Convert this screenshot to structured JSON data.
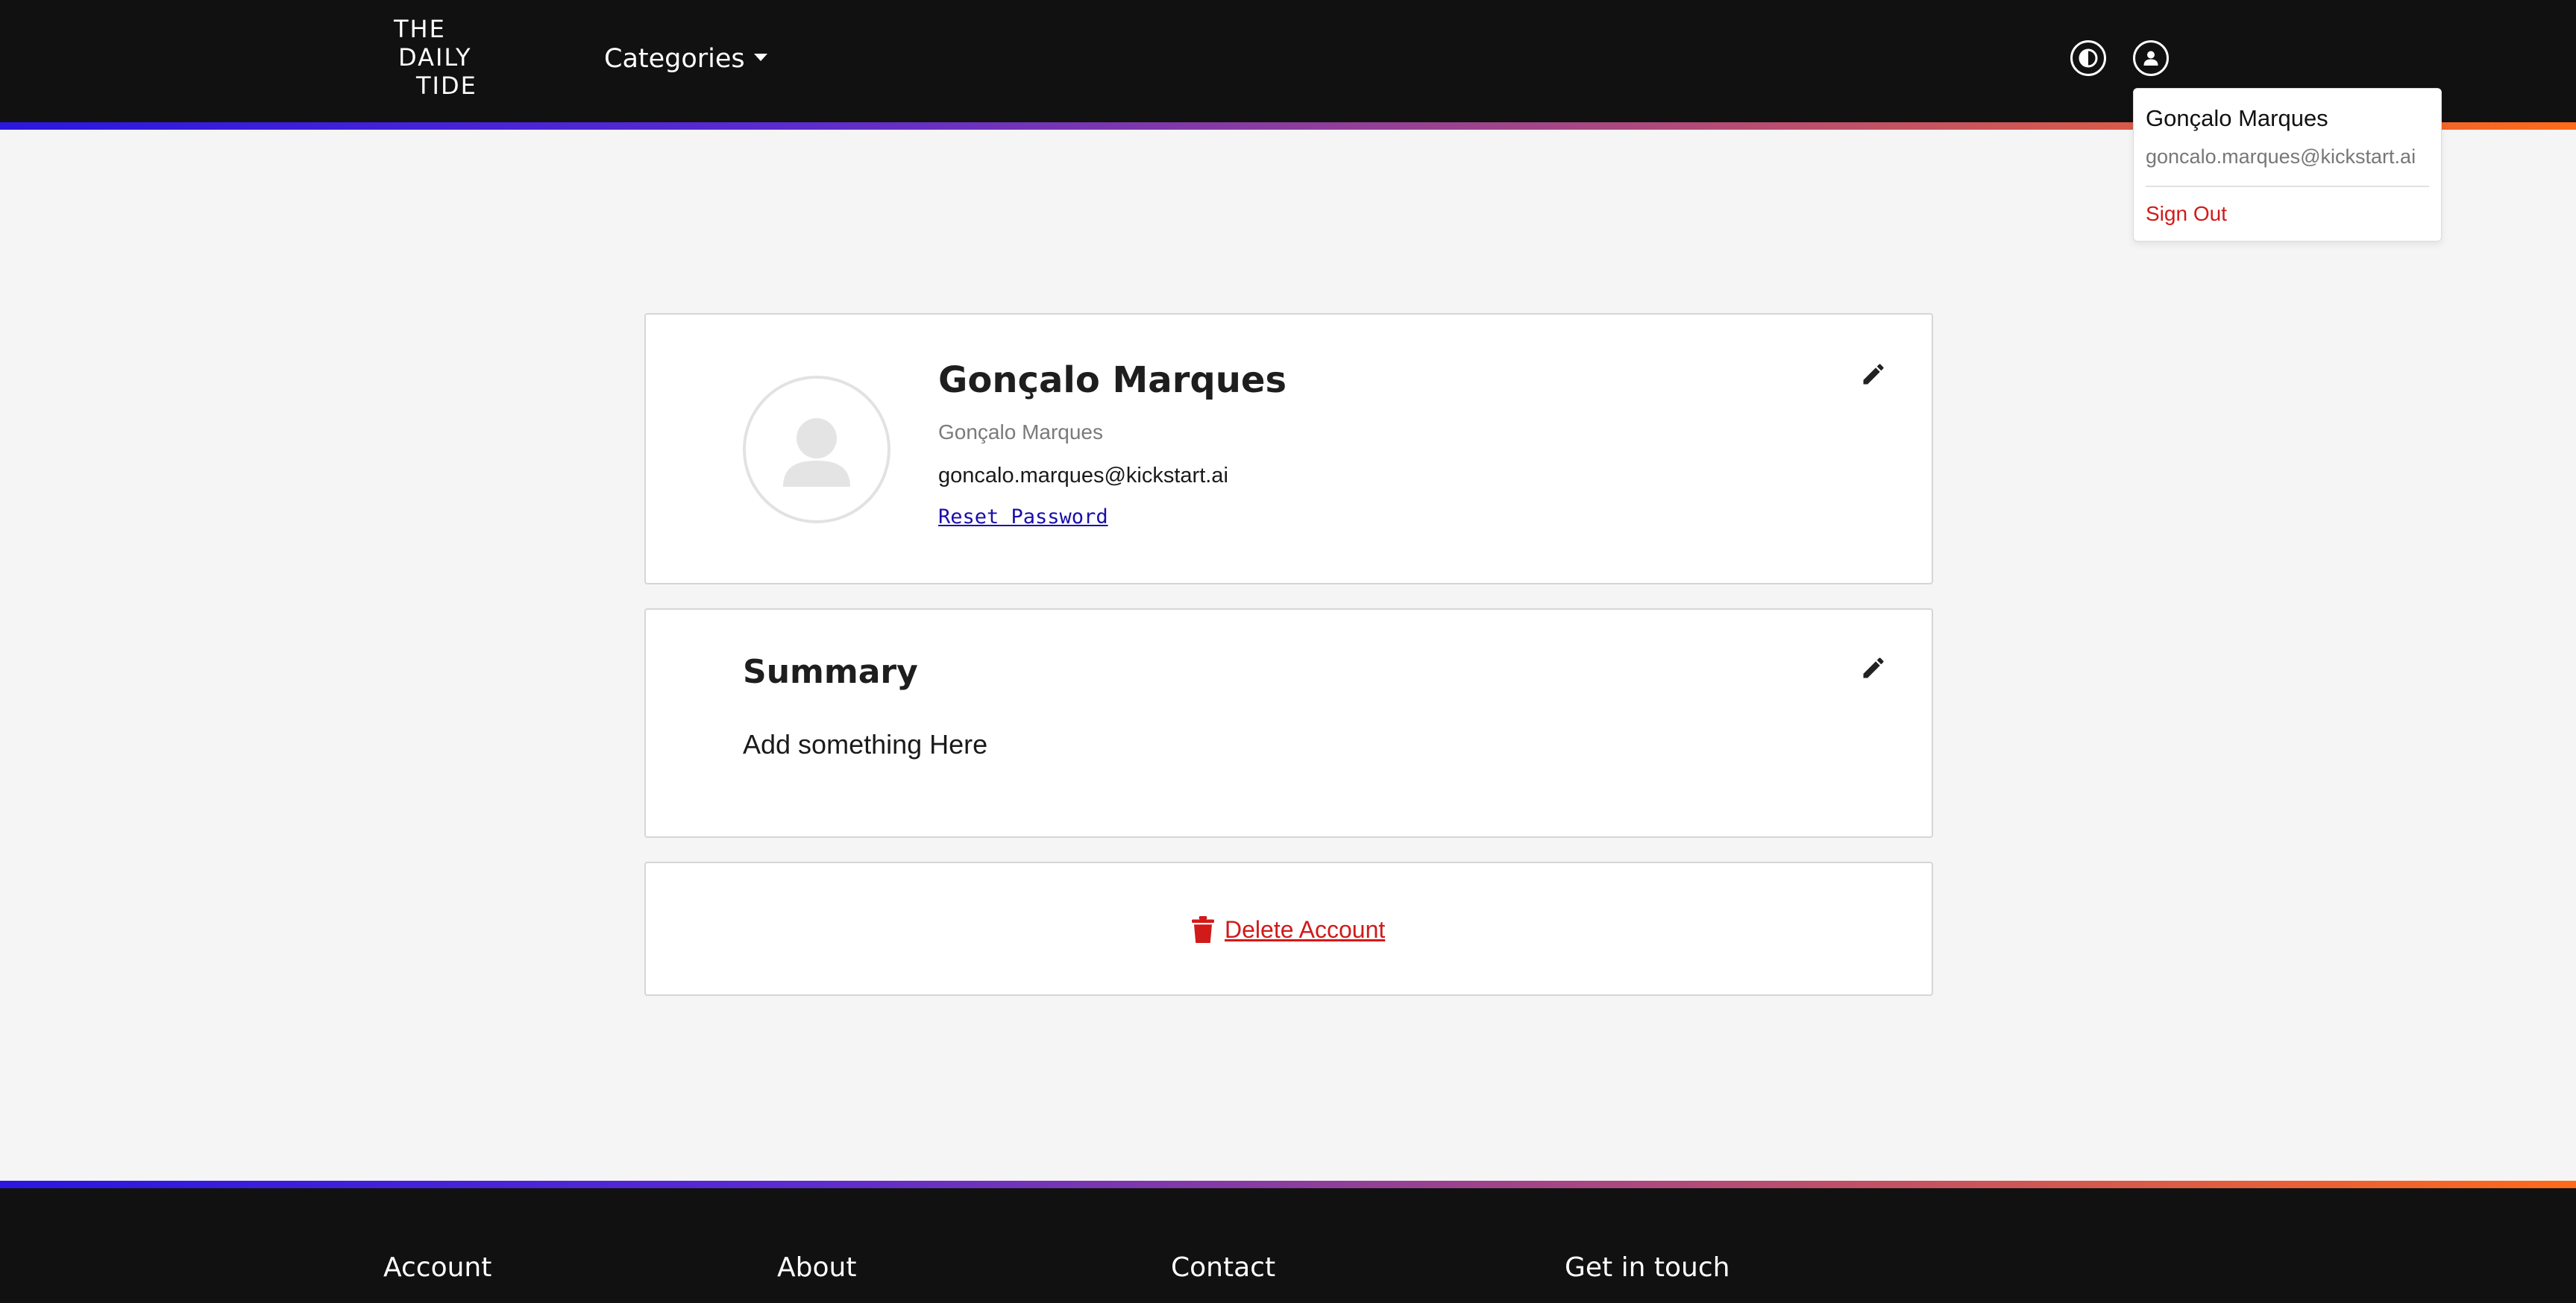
{
  "header": {
    "logo": {
      "line1": "THE",
      "line2": "DAILY",
      "line3": "TIDE"
    },
    "categories_label": "Categories",
    "theme_toggle_icon": "contrast-icon",
    "user_menu_icon": "user-icon"
  },
  "user_dropdown": {
    "name": "Gonçalo Marques",
    "email": "goncalo.marques@kickstart.ai",
    "sign_out_label": "Sign Out"
  },
  "profile": {
    "avatar_icon": "user-placeholder-icon",
    "display_name": "Gonçalo Marques",
    "username": "Gonçalo Marques",
    "email": "goncalo.marques@kickstart.ai",
    "reset_password_label": "Reset Password",
    "edit_icon": "pencil-icon"
  },
  "summary": {
    "title": "Summary",
    "text": "Add something Here",
    "edit_icon": "pencil-icon"
  },
  "danger": {
    "delete_label": "Delete Account",
    "delete_icon": "trash-icon"
  },
  "footer": {
    "columns": [
      {
        "heading": "Account"
      },
      {
        "heading": "About"
      },
      {
        "heading": "Contact"
      },
      {
        "heading": "Get in touch"
      }
    ]
  },
  "colors": {
    "header_bg": "#111111",
    "page_bg": "#f5f5f5",
    "danger": "#d11a1a",
    "link": "#1a0dab",
    "gradient_start": "#2a17e0",
    "gradient_end": "#ff6a1a"
  }
}
